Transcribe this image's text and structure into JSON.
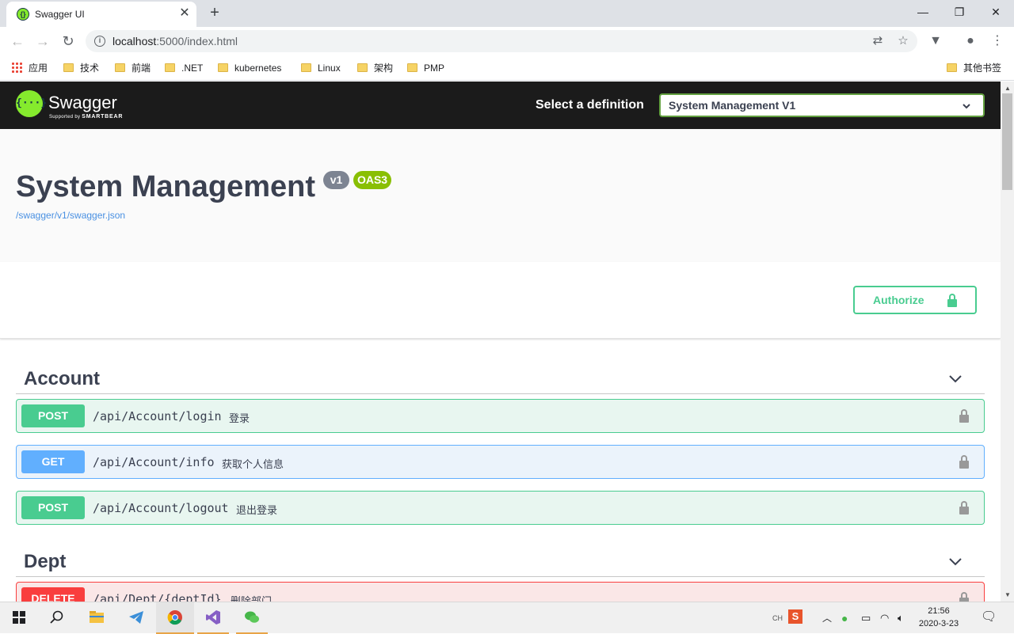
{
  "browser": {
    "tab_title": "Swagger UI",
    "url_host": "localhost",
    "url_rest": ":5000/index.html",
    "bookmarks": [
      "应用",
      "技术",
      "前端",
      ".NET",
      "kubernetes",
      "Linux",
      "架构",
      "PMP"
    ],
    "other_bookmarks": "其他书签"
  },
  "topbar": {
    "logo_text": "Swagger",
    "logo_sub_prefix": "Supported by",
    "logo_sub_brand": "SMARTBEAR",
    "definition_label": "Select a definition",
    "definition_selected": "System Management V1"
  },
  "info": {
    "title": "System Management",
    "version_badge": "v1",
    "oas_badge": "OAS3",
    "spec_link": "/swagger/v1/swagger.json"
  },
  "auth": {
    "button_label": "Authorize"
  },
  "tags": [
    {
      "name": "Account",
      "operations": [
        {
          "method": "POST",
          "path": "/api/Account/login",
          "summary": "登录"
        },
        {
          "method": "GET",
          "path": "/api/Account/info",
          "summary": "获取个人信息"
        },
        {
          "method": "POST",
          "path": "/api/Account/logout",
          "summary": "退出登录"
        }
      ]
    },
    {
      "name": "Dept",
      "operations": [
        {
          "method": "DELETE",
          "path": "/api/Dept/{deptId}",
          "summary": "删除部门"
        }
      ]
    }
  ],
  "taskbar": {
    "ime": "CH",
    "time": "21:56",
    "date": "2020-3-23"
  },
  "colors": {
    "post": "#49cc90",
    "get": "#61affe",
    "delete": "#f93e3e",
    "swagger_green": "#85ea2d",
    "topbar_bg": "#1b1b1b"
  }
}
